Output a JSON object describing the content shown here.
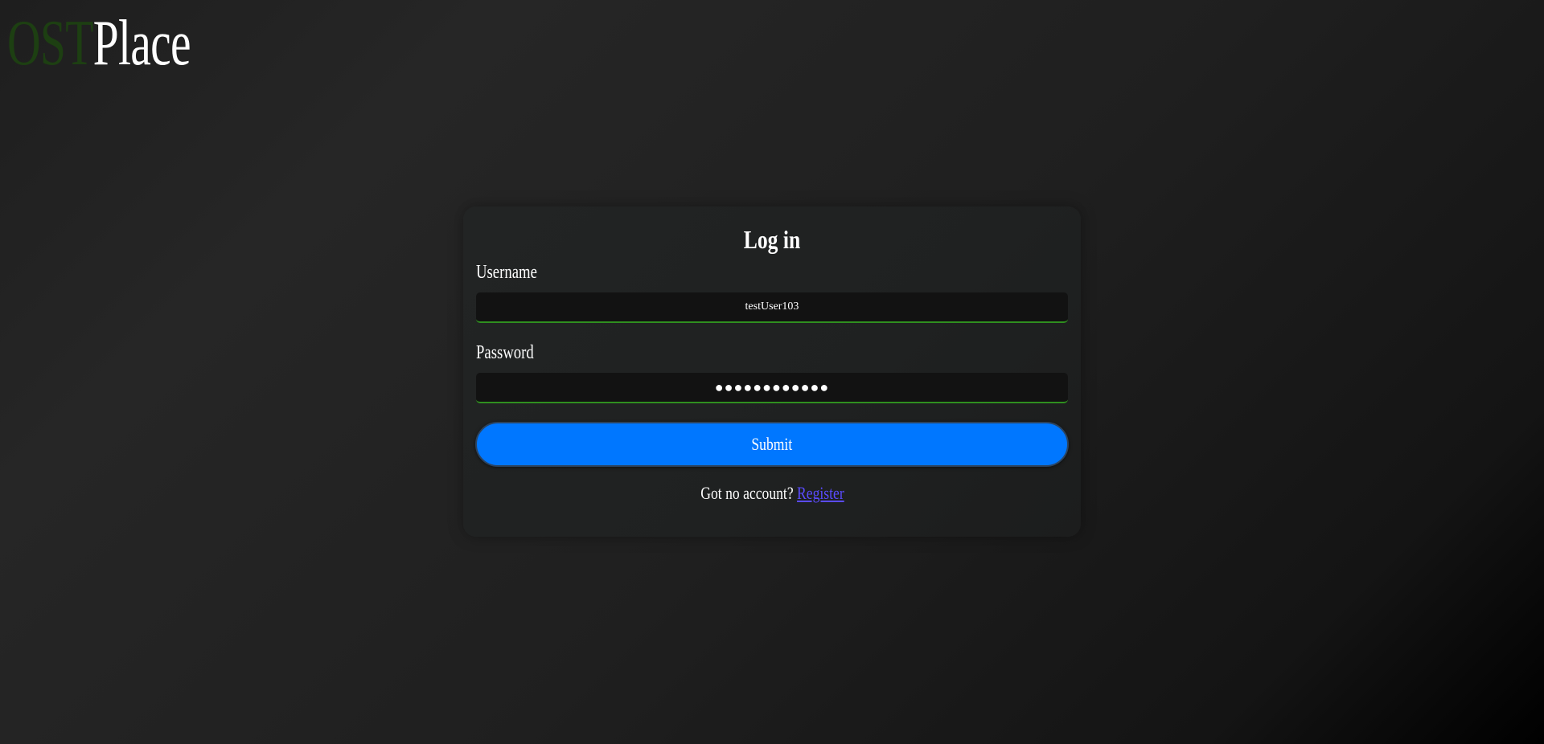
{
  "logo": {
    "accent_text": "OST",
    "main_text": "Place"
  },
  "login": {
    "title": "Log in",
    "username_label": "Username",
    "username_value": "testUser103",
    "password_label": "Password",
    "password_value": "●●●●●●●●●●●●",
    "submit_label": "Submit",
    "no_account_text": "Got no account?",
    "register_link": "Register"
  },
  "colors": {
    "submit_bg": "#0077ff",
    "input_underline": "#2f8f1f",
    "logo_accent": "#1d3f12",
    "register_link": "#5a4bff"
  }
}
